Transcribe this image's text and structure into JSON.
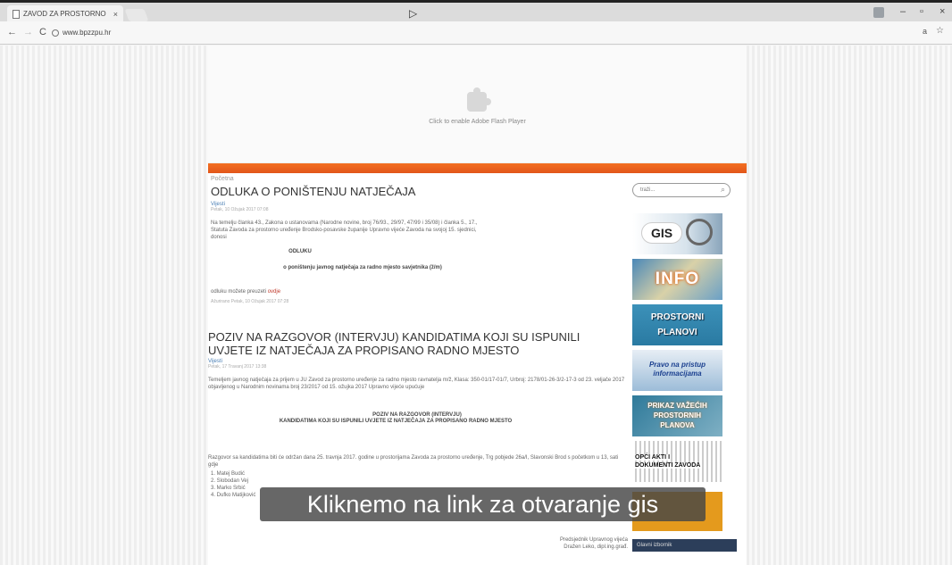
{
  "browser": {
    "tab_title": "ZAVOD ZA PROSTORNO",
    "tab_close": "×",
    "url": "www.bpzzpu.hr",
    "nav_back": "←",
    "nav_forward": "→",
    "nav_reload": "C",
    "win_min": "–",
    "win_max": "▫",
    "win_close": "×",
    "cursor": "▷",
    "star": "☆",
    "translate": "a"
  },
  "flash": {
    "message": "Click to enable Adobe Flash Player"
  },
  "breadcrumb": "Početna",
  "articles": [
    {
      "title": "ODLUKA O PONIŠTENJU NATJEČAJA",
      "author": "Vijesti",
      "date": "Petak, 10 Ožujak 2017 07:08",
      "intro": "Na temelju članka 43., Zakona o ustanovama (Narodne novine, broj 76/93., 29/97, 47/99 i 35/08) i članka 5., 17., Statuta Zavoda za prostorno uređenje Brodsko-posavske županije Upravno vijeće Zavoda na svojoj 15. sjednici, donosi",
      "heading": "ODLUKU",
      "subheading": "o poništenju javnog natječaja za radno mjesto savjetnika (ž/m)",
      "link_prefix": "odluku možete preuzeti",
      "link_word": "ovdje",
      "modified": "Ažurirano Petak, 10 Ožujak 2017 07:28"
    },
    {
      "title": "POZIV NA RAZGOVOR (INTERVJU) KANDIDATIMA KOJI SU ISPUNILI UVJETE IZ NATJEČAJA ZA PROPISANO RADNO MJESTO",
      "author": "Vijesti",
      "date": "Petak, 17 Travanj 2017 13:38",
      "intro": "Temeljem javnog natječaja za prijem u JU Zavod za prostorno uređenje za radno mjesto ravnatelja m/ž, Klasa: 350-01/17-01/7, Urbroj: 2178/01-26-3/2-17-3 od 23. veljače 2017 objavljenog u Narodnim novinama broj 23/2017 od 15. ožujka 2017 Upravno vijeće upućuje",
      "heading": "POZIV NA RAZGOVOR (INTERVJU)",
      "subheading": "KANDIDATIMA KOJI SU ISPUNILI UVJETE IZ NATJEČAJA ZA PROPISANO RADNO MJESTO",
      "paragraph": "Razgovor sa kandidatima biti će održan dana 25. travnja 2017. godine u prostorijama Zavoda za prostorno uređenje, Trg pobjede 26a/I, Slavonski Brod s početkom u 13, sati gdje",
      "candidates": [
        "1.  Matej Budić",
        "2.  Slobodan Vej",
        "3.  Marko Srbić",
        "4.  Dufko Matijković"
      ]
    }
  ],
  "sidebar": {
    "search_placeholder": "traži...",
    "banners": {
      "gis": "GIS",
      "info": "INFO",
      "planovi_line1": "PROSTORNI",
      "planovi_line2": "PLANOVI",
      "pravo_line1": "Pravo na pristup",
      "pravo_line2": "informacijama",
      "prikaz_line1": "PRIKAZ VAŽEĆIH",
      "prikaz_line2": "PROSTORNIH",
      "prikaz_line3": "PLANOVA",
      "opci_line1": "OPĆI AKTI I",
      "opci_line2": "DOKUMENTI ZAVODA"
    },
    "footer_button": "Glavni izbornik"
  },
  "footer": {
    "line1": "Predsjednik Upravnog vijeća",
    "line2": "Dražen Leko, dipl.ing.građ."
  },
  "caption": "Kliknemo na link za otvaranje gis",
  "colors": {
    "accent_orange": "#f36f21",
    "link_blue": "#4a7fb5",
    "caption_bg": "#464646"
  }
}
